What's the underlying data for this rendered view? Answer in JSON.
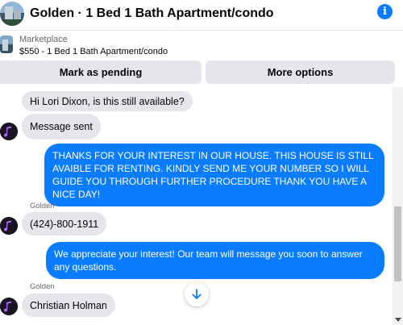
{
  "header": {
    "title": "Golden · 1 Bed 1 Bath Apartment/condo",
    "info_icon": "info-icon",
    "info_glyph": "i"
  },
  "listing": {
    "source": "Marketplace",
    "price_title": "$550 - 1 Bed 1 Bath Apartment/condo"
  },
  "actions": {
    "mark_pending": "Mark as pending",
    "more_options": "More options"
  },
  "messages": [
    {
      "from": "them",
      "text": "Hi Lori Dixon, is this still available?"
    },
    {
      "from": "them",
      "text": "Message sent"
    },
    {
      "from": "me",
      "text": "THANKS FOR YOUR INTEREST IN OUR HOUSE. THIS HOUSE IS STILL AVAIBLE FOR RENTING. KINDLY SEND ME YOUR NUMBER SO I WILL GUIDE YOU THROUGH FURTHER PROCEDURE THANK YOU HAVE A NICE DAY!"
    },
    {
      "from": "them",
      "sender": "Golden",
      "text": "(424)-800-1911"
    },
    {
      "from": "me",
      "text": "We appreciate your interest! Our team will message you soon to answer any questions."
    },
    {
      "from": "them",
      "sender": "Golden",
      "text": "Christian Holman"
    }
  ],
  "scroll_down_icon": "arrow-down-icon",
  "colors": {
    "accent": "#0a7cff",
    "bubble_in": "#e4e6eb",
    "button_bg": "#e4e6eb",
    "secondary_text": "#65676b"
  }
}
